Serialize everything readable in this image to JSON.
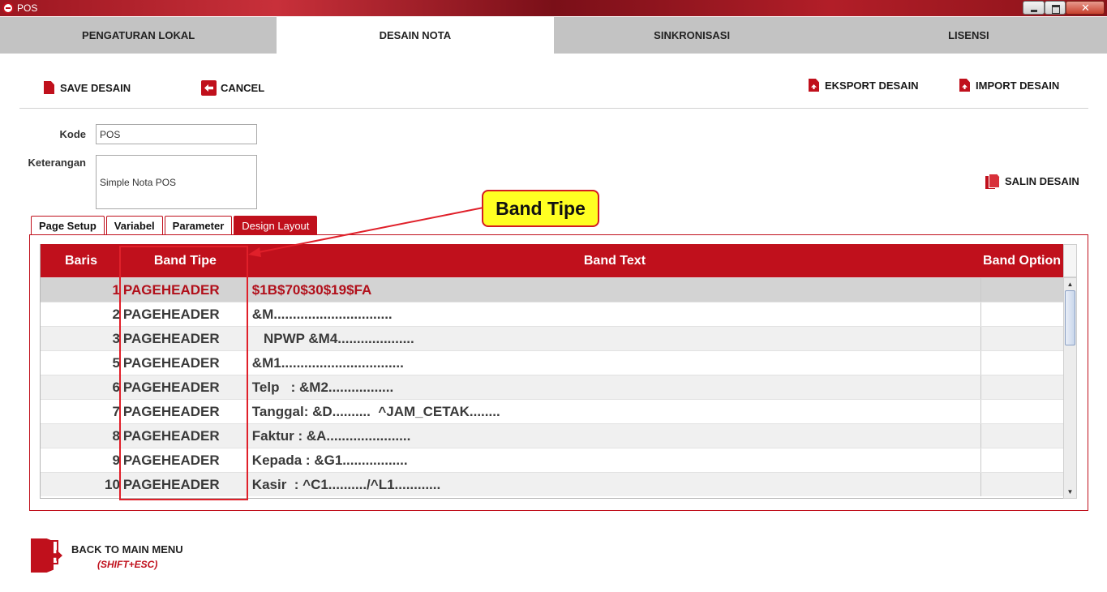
{
  "window": {
    "title": "POS"
  },
  "main_tabs": [
    {
      "label": "PENGATURAN LOKAL",
      "active": false
    },
    {
      "label": "DESAIN NOTA",
      "active": true
    },
    {
      "label": "SINKRONISASI",
      "active": false
    },
    {
      "label": "LISENSI",
      "active": false
    }
  ],
  "toolbar": {
    "save_label": "SAVE DESAIN",
    "cancel_label": "CANCEL",
    "export_label": "EKSPORT DESAIN",
    "import_label": "IMPORT DESAIN",
    "copy_label": "SALIN DESAIN"
  },
  "form": {
    "kode_label": "Kode",
    "kode_value": "POS",
    "keterangan_label": "Keterangan",
    "keterangan_value": "Simple Nota POS"
  },
  "sub_tabs": [
    {
      "label": "Page Setup",
      "active": false
    },
    {
      "label": "Variabel",
      "active": false
    },
    {
      "label": "Parameter",
      "active": false
    },
    {
      "label": "Design Layout",
      "active": true
    }
  ],
  "table": {
    "headers": {
      "baris": "Baris",
      "band_tipe": "Band Tipe",
      "band_text": "Band Text",
      "band_option": "Band Option"
    },
    "rows": [
      {
        "baris": "1",
        "band_tipe": "PAGEHEADER",
        "band_text": "$1B$70$30$19$FA",
        "selected": true
      },
      {
        "baris": "2",
        "band_tipe": "PAGEHEADER",
        "band_text": "&M..............................."
      },
      {
        "baris": "3",
        "band_tipe": "PAGEHEADER",
        "band_text": "   NPWP &M4...................."
      },
      {
        "baris": "5",
        "band_tipe": "PAGEHEADER",
        "band_text": "&M1................................"
      },
      {
        "baris": "6",
        "band_tipe": "PAGEHEADER",
        "band_text": "Telp   : &M2................."
      },
      {
        "baris": "7",
        "band_tipe": "PAGEHEADER",
        "band_text": "Tanggal: &D..........  ^JAM_CETAK........"
      },
      {
        "baris": "8",
        "band_tipe": "PAGEHEADER",
        "band_text": "Faktur : &A......................"
      },
      {
        "baris": "9",
        "band_tipe": "PAGEHEADER",
        "band_text": "Kepada : &G1................."
      },
      {
        "baris": "10",
        "band_tipe": "PAGEHEADER",
        "band_text": "Kasir  : ^C1........../^L1............"
      }
    ]
  },
  "annotation": {
    "label": "Band Tipe"
  },
  "back": {
    "label": "BACK TO MAIN MENU",
    "shortcut": "(SHIFT+ESC)"
  },
  "colors": {
    "accent": "#c0101c",
    "callout": "#ffff22"
  }
}
